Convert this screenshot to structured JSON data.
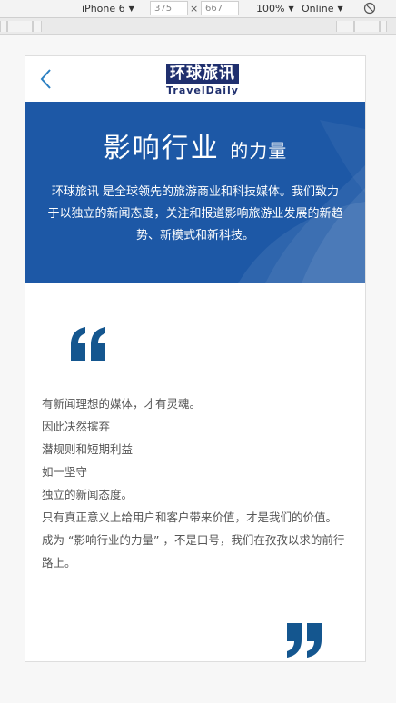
{
  "devtools": {
    "device": "iPhone 6",
    "width": "375",
    "height": "667",
    "times": "×",
    "zoom": "100%",
    "network": "Online"
  },
  "header": {
    "logo_cn": "环球旅讯",
    "logo_en": "TravelDaily"
  },
  "banner": {
    "title_main": "影响行业",
    "title_small": "的力量",
    "description": "环球旅讯 是全球领先的旅游商业和科技媒体。我们致力于以独立的新闻态度，关注和报道影响旅游业发展的新趋势、新模式和新科技。"
  },
  "content": {
    "lines": [
      "有新闻理想的媒体，才有灵魂。",
      "因此决然摈弃",
      "潜规则和短期利益",
      "如一坚守",
      "独立的新闻态度。",
      "只有真正意义上给用户和客户带来价值，才是我们的价值。",
      "成为 “影响行业的力量” ，不是口号，我们在孜孜以求的前行路上。"
    ]
  },
  "colors": {
    "brand_blue": "#1d58a6",
    "logo_navy": "#1f2f6e",
    "quote_blue": "#14568f"
  }
}
